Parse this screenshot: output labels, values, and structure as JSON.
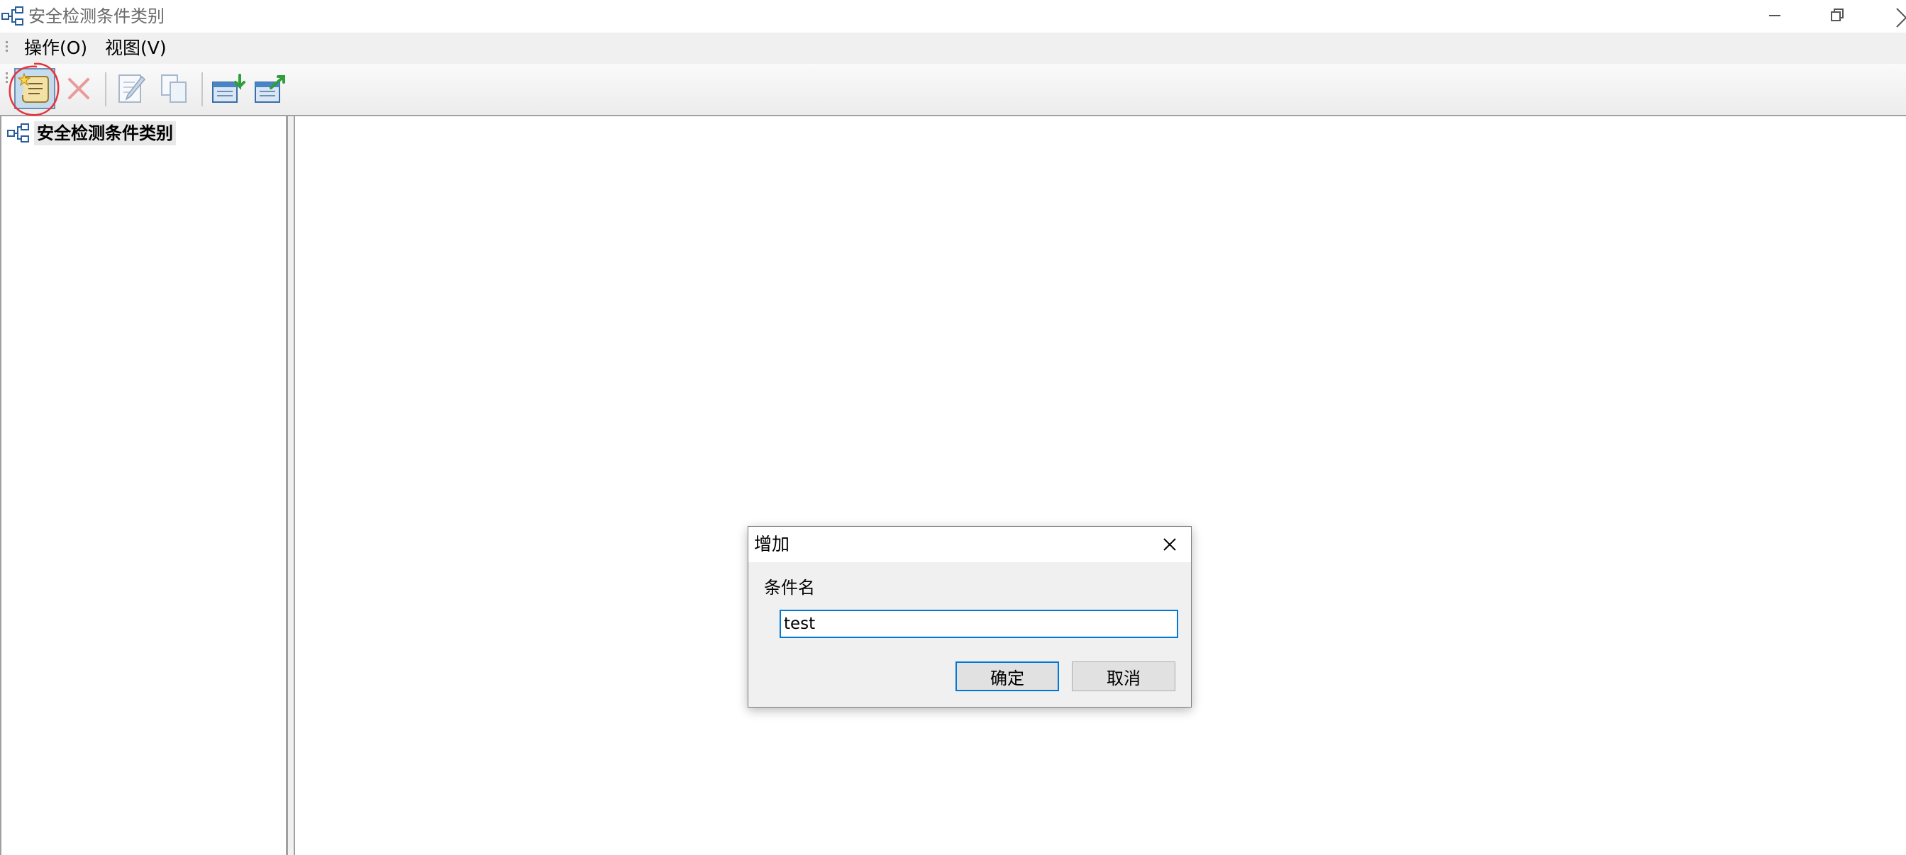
{
  "window": {
    "title": "安全检测条件类别",
    "icons": {
      "app": "tree-structure-icon",
      "minimize": "minimize-icon",
      "restore": "restore-icon",
      "close": "close-icon"
    }
  },
  "menu": {
    "items": [
      {
        "label": "操作(O)"
      },
      {
        "label": "视图(V)"
      }
    ]
  },
  "toolbar": {
    "buttons": [
      {
        "icon": "add-scroll-icon",
        "state": "hovered",
        "annotated": true
      },
      {
        "icon": "delete-x-icon",
        "state": "disabled"
      },
      {
        "icon": "edit-document-icon",
        "state": "disabled"
      },
      {
        "icon": "copy-documents-icon",
        "state": "disabled"
      },
      {
        "icon": "import-icon",
        "state": "enabled"
      },
      {
        "icon": "export-icon",
        "state": "enabled"
      }
    ],
    "annotation_color": "#e8323c"
  },
  "tree": {
    "root": {
      "label": "安全检测条件类别",
      "icon": "tree-structure-icon"
    }
  },
  "dialog": {
    "title": "增加",
    "field_label": "条件名",
    "field_value": "test",
    "ok_label": "确定",
    "cancel_label": "取消",
    "accent": "#0078d7"
  }
}
